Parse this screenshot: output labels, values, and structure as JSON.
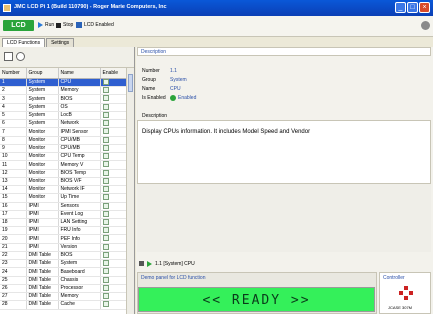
{
  "window": {
    "title": "JMC LCD Pi 1 (Build 110790) - Roger Marie Computers, Inc"
  },
  "toolbar": {
    "logo": "LCD",
    "run_label": "Run",
    "stop_label": "Stop",
    "lcd_enabled_label": "LCD Enabled"
  },
  "tabs": [
    {
      "label": "LCD Functions"
    },
    {
      "label": "Settings"
    }
  ],
  "table": {
    "columns": [
      "Number",
      "Group",
      "Name",
      "Enable"
    ],
    "rows": [
      [
        "1",
        "System",
        "CPU"
      ],
      [
        "2",
        "System",
        "Memory"
      ],
      [
        "3",
        "System",
        "BIOS"
      ],
      [
        "4",
        "System",
        "OS"
      ],
      [
        "5",
        "System",
        "LocB"
      ],
      [
        "6",
        "System",
        "Network"
      ],
      [
        "7",
        "Monitor",
        "IPMI Sensor"
      ],
      [
        "8",
        "Monitor",
        "CPU/MB"
      ],
      [
        "9",
        "Monitor",
        "CPU/MB"
      ],
      [
        "10",
        "Monitor",
        "CPU Temp"
      ],
      [
        "11",
        "Monitor",
        "Memory V"
      ],
      [
        "12",
        "Monitor",
        "BIOS Temp"
      ],
      [
        "13",
        "Monitor",
        "BIOS V/F"
      ],
      [
        "14",
        "Monitor",
        "Network IF"
      ],
      [
        "15",
        "Monitor",
        "Up Time"
      ],
      [
        "16",
        "IPMI",
        "Sensors"
      ],
      [
        "17",
        "IPMI",
        "Event Log"
      ],
      [
        "18",
        "IPMI",
        "LAN Setting"
      ],
      [
        "19",
        "IPMI",
        "FRU Info"
      ],
      [
        "20",
        "IPMI",
        "PEF Info"
      ],
      [
        "21",
        "IPMI",
        "Version"
      ],
      [
        "22",
        "DMI Table",
        "BIOS"
      ],
      [
        "23",
        "DMI Table",
        "System"
      ],
      [
        "24",
        "DMI Table",
        "Baseboard"
      ],
      [
        "25",
        "DMI Table",
        "Chassis"
      ],
      [
        "26",
        "DMI Table",
        "Processor"
      ],
      [
        "27",
        "DMI Table",
        "Memory"
      ],
      [
        "28",
        "DMI Table",
        "Cache"
      ]
    ],
    "selected_index": 0
  },
  "description": {
    "header": "Description",
    "number_label": "Number",
    "number_value": "1.1",
    "group_label": "Group",
    "group_value": "System",
    "name_label": "Name",
    "name_value": "CPU",
    "enabled_label": "Is Enabled",
    "enabled_value": "Enabled",
    "desc_label": "Description",
    "desc_text": "Display CPUs information. It includes Model Speed and Vendor"
  },
  "lcd": {
    "breadcrumb": "1.1 [System] CPU",
    "panel_caption": "Demo panel for LCD function",
    "screen_text": "<< READY >>"
  },
  "controller": {
    "caption": "Controller",
    "name": "JCASE 307M"
  },
  "colors": {
    "lcd": "#34f05a",
    "selection": "#2f5fd0",
    "title": "#0a58d8"
  }
}
